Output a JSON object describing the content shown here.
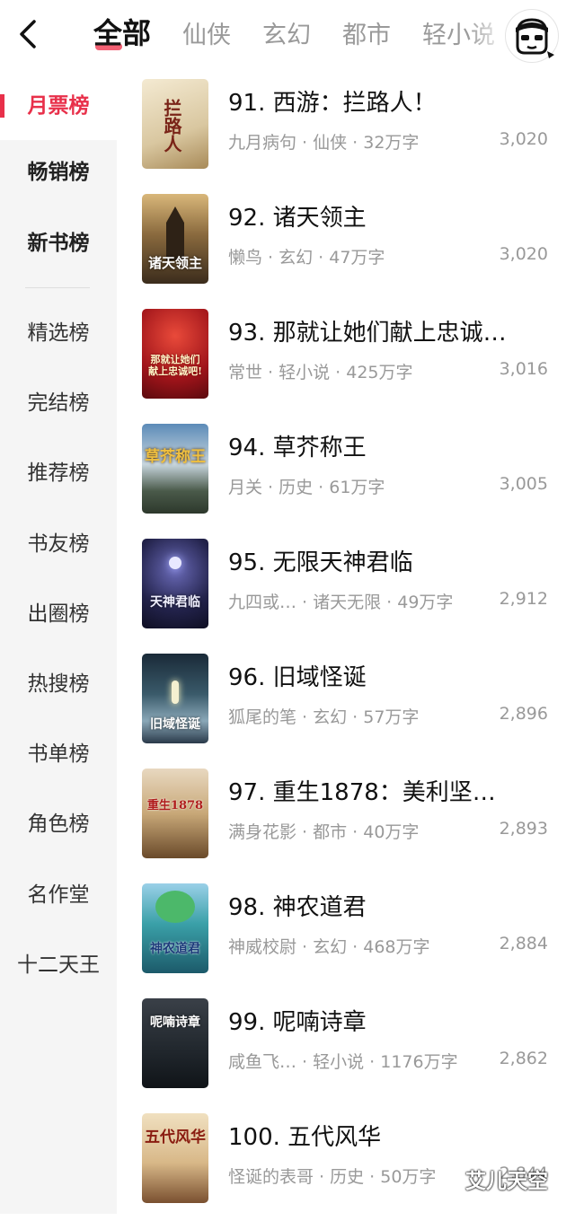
{
  "header": {
    "tabs": [
      {
        "label": "全部",
        "active": true
      },
      {
        "label": "仙侠"
      },
      {
        "label": "玄幻"
      },
      {
        "label": "都市"
      },
      {
        "label": "轻小说"
      }
    ],
    "back_icon": "chevron-left-icon",
    "avatar_icon": "user-avatar-icon",
    "accent_color": "#e8304a"
  },
  "sidebar": {
    "items": [
      {
        "label": "月票榜",
        "active": true
      },
      {
        "label": "畅销榜"
      },
      {
        "label": "新书榜"
      },
      {
        "label": "精选榜"
      },
      {
        "label": "完结榜"
      },
      {
        "label": "推荐榜"
      },
      {
        "label": "书友榜"
      },
      {
        "label": "出圈榜"
      },
      {
        "label": "热搜榜"
      },
      {
        "label": "书单榜"
      },
      {
        "label": "角色榜"
      },
      {
        "label": "名作堂"
      },
      {
        "label": "十二天王"
      }
    ]
  },
  "books": [
    {
      "title": "91. 西游：拦路人！",
      "meta": "九月病句 · 仙侠 · 32万字",
      "votes": "3,020",
      "cover_text": "拦路人"
    },
    {
      "title": "92. 诸天领主",
      "meta": "懒鸟 · 玄幻 · 47万字",
      "votes": "3,020",
      "cover_text": "诸天领主"
    },
    {
      "title": "93. 那就让她们献上忠诚…",
      "meta": "常世 · 轻小说 · 425万字",
      "votes": "3,016",
      "cover_text": "那就让她们献上忠诚吧!"
    },
    {
      "title": "94. 草芥称王",
      "meta": "月关 · 历史 · 61万字",
      "votes": "3,005",
      "cover_text": "草芥称王"
    },
    {
      "title": "95. 无限天神君临",
      "meta": "九四或… · 诸天无限 · 49万字",
      "votes": "2,912",
      "cover_text": "天神君临"
    },
    {
      "title": "96. 旧域怪诞",
      "meta": "狐尾的笔 · 玄幻 · 57万字",
      "votes": "2,896",
      "cover_text": "旧域怪诞"
    },
    {
      "title": "97. 重生1878：美利坚…",
      "meta": "满身花影 · 都市 · 40万字",
      "votes": "2,893",
      "cover_text": "重生1878"
    },
    {
      "title": "98. 神农道君",
      "meta": "神威校尉 · 玄幻 · 468万字",
      "votes": "2,884",
      "cover_text": "神农道君"
    },
    {
      "title": "99. 呢喃诗章",
      "meta": "咸鱼飞… · 轻小说 · 1176万字",
      "votes": "2,862",
      "cover_text": "呢喃诗章"
    },
    {
      "title": "100. 五代风华",
      "meta": "怪诞的表哥 · 历史 · 50万字",
      "votes": "2,844",
      "cover_text": "五代风华"
    }
  ],
  "watermark": "艾儿天空"
}
